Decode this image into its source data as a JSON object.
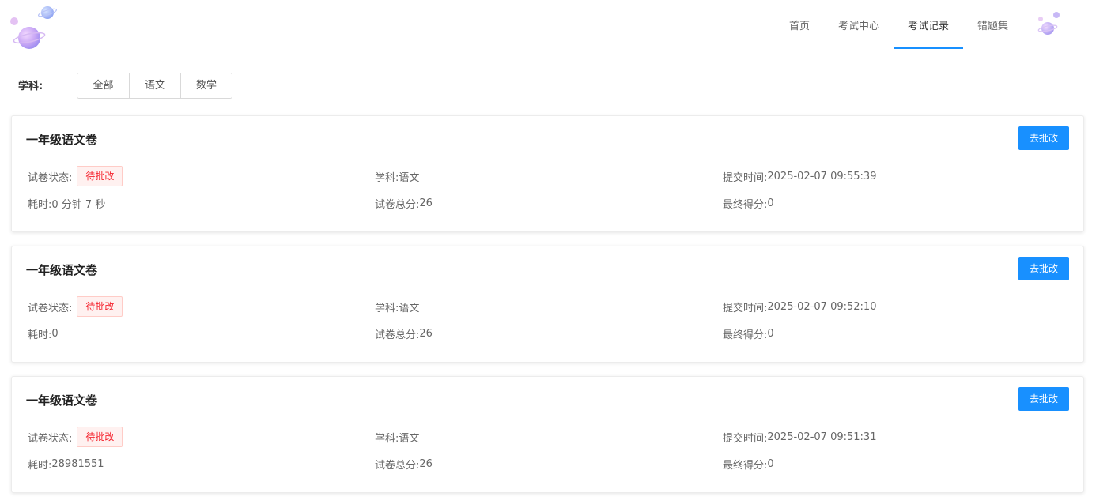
{
  "nav": {
    "items": [
      "首页",
      "考试中心",
      "考试记录",
      "错题集"
    ],
    "active_index": 2
  },
  "filter": {
    "label": "学科:",
    "options": [
      "全部",
      "语文",
      "数学"
    ]
  },
  "labels": {
    "status": "试卷状态:",
    "subject": "学科:",
    "submit_time": "提交时间:",
    "duration": "耗时:",
    "total_score": "试卷总分:",
    "final_score": "最终得分:"
  },
  "records": [
    {
      "title": "一年级语文卷",
      "action_label": "去批改",
      "status": "待批改",
      "subject": "语文",
      "submit_time": "2025-02-07 09:55:39",
      "duration": "0 分钟 7 秒",
      "total_score": "26",
      "final_score": "0"
    },
    {
      "title": "一年级语文卷",
      "action_label": "去批改",
      "status": "待批改",
      "subject": "语文",
      "submit_time": "2025-02-07 09:52:10",
      "duration": "0",
      "total_score": "26",
      "final_score": "0"
    },
    {
      "title": "一年级语文卷",
      "action_label": "去批改",
      "status": "待批改",
      "subject": "语文",
      "submit_time": "2025-02-07 09:51:31",
      "duration": "28981551",
      "total_score": "26",
      "final_score": "0"
    }
  ],
  "colors": {
    "accent": "#1890ff",
    "status_text": "#f5222d",
    "status_bg": "#fff1f0"
  },
  "icons": {
    "logo": "planet-logo-icon",
    "avatar": "planet-avatar-icon"
  }
}
